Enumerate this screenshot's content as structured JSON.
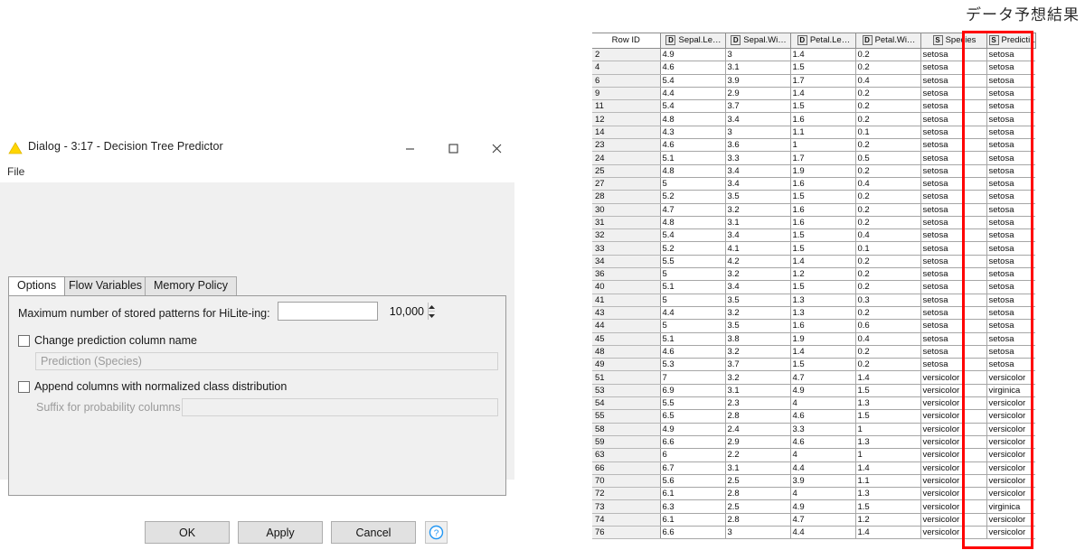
{
  "caption": "データ予想結果",
  "dialog": {
    "title": "Dialog - 3:17 - Decision Tree Predictor",
    "app_icon": "knime-triangle-icon",
    "window_controls": {
      "minimize": "minimize-icon",
      "maximize": "maximize-icon",
      "close": "close-icon"
    },
    "menu": {
      "file": "File"
    },
    "tabs": [
      {
        "label": "Options",
        "selected": true
      },
      {
        "label": "Flow Variables",
        "selected": false
      },
      {
        "label": "Memory Policy",
        "selected": false
      }
    ],
    "options": {
      "max_patterns_label": "Maximum number of stored patterns for HiLite-ing:",
      "max_patterns_value": "10,000",
      "change_prediction_checkbox": "Change prediction column name",
      "change_prediction_checked": false,
      "prediction_name_value": "Prediction (Species)",
      "append_distribution_checkbox": "Append columns with normalized class distribution",
      "append_distribution_checked": false,
      "suffix_label": "Suffix for probability columns",
      "suffix_value": ""
    },
    "buttons": {
      "ok": "OK",
      "apply": "Apply",
      "cancel": "Cancel",
      "help": "?"
    }
  },
  "colors": {
    "highlight": "#ff0000",
    "knime_yellow": "#ffd500",
    "help_blue": "#2196f3"
  },
  "table": {
    "columns": [
      {
        "label": "Row ID",
        "type": ""
      },
      {
        "label": "Sepal.Le…",
        "type": "D"
      },
      {
        "label": "Sepal.Wi…",
        "type": "D"
      },
      {
        "label": "Petal.Le…",
        "type": "D"
      },
      {
        "label": "Petal.Wi…",
        "type": "D"
      },
      {
        "label": "Species",
        "type": "S"
      },
      {
        "label": "Predicti…",
        "type": "S"
      }
    ],
    "highlighted_column_index": 6,
    "rows": [
      [
        "2",
        "4.9",
        "3",
        "1.4",
        "0.2",
        "setosa",
        "setosa"
      ],
      [
        "4",
        "4.6",
        "3.1",
        "1.5",
        "0.2",
        "setosa",
        "setosa"
      ],
      [
        "6",
        "5.4",
        "3.9",
        "1.7",
        "0.4",
        "setosa",
        "setosa"
      ],
      [
        "9",
        "4.4",
        "2.9",
        "1.4",
        "0.2",
        "setosa",
        "setosa"
      ],
      [
        "11",
        "5.4",
        "3.7",
        "1.5",
        "0.2",
        "setosa",
        "setosa"
      ],
      [
        "12",
        "4.8",
        "3.4",
        "1.6",
        "0.2",
        "setosa",
        "setosa"
      ],
      [
        "14",
        "4.3",
        "3",
        "1.1",
        "0.1",
        "setosa",
        "setosa"
      ],
      [
        "23",
        "4.6",
        "3.6",
        "1",
        "0.2",
        "setosa",
        "setosa"
      ],
      [
        "24",
        "5.1",
        "3.3",
        "1.7",
        "0.5",
        "setosa",
        "setosa"
      ],
      [
        "25",
        "4.8",
        "3.4",
        "1.9",
        "0.2",
        "setosa",
        "setosa"
      ],
      [
        "27",
        "5",
        "3.4",
        "1.6",
        "0.4",
        "setosa",
        "setosa"
      ],
      [
        "28",
        "5.2",
        "3.5",
        "1.5",
        "0.2",
        "setosa",
        "setosa"
      ],
      [
        "30",
        "4.7",
        "3.2",
        "1.6",
        "0.2",
        "setosa",
        "setosa"
      ],
      [
        "31",
        "4.8",
        "3.1",
        "1.6",
        "0.2",
        "setosa",
        "setosa"
      ],
      [
        "32",
        "5.4",
        "3.4",
        "1.5",
        "0.4",
        "setosa",
        "setosa"
      ],
      [
        "33",
        "5.2",
        "4.1",
        "1.5",
        "0.1",
        "setosa",
        "setosa"
      ],
      [
        "34",
        "5.5",
        "4.2",
        "1.4",
        "0.2",
        "setosa",
        "setosa"
      ],
      [
        "36",
        "5",
        "3.2",
        "1.2",
        "0.2",
        "setosa",
        "setosa"
      ],
      [
        "40",
        "5.1",
        "3.4",
        "1.5",
        "0.2",
        "setosa",
        "setosa"
      ],
      [
        "41",
        "5",
        "3.5",
        "1.3",
        "0.3",
        "setosa",
        "setosa"
      ],
      [
        "43",
        "4.4",
        "3.2",
        "1.3",
        "0.2",
        "setosa",
        "setosa"
      ],
      [
        "44",
        "5",
        "3.5",
        "1.6",
        "0.6",
        "setosa",
        "setosa"
      ],
      [
        "45",
        "5.1",
        "3.8",
        "1.9",
        "0.4",
        "setosa",
        "setosa"
      ],
      [
        "48",
        "4.6",
        "3.2",
        "1.4",
        "0.2",
        "setosa",
        "setosa"
      ],
      [
        "49",
        "5.3",
        "3.7",
        "1.5",
        "0.2",
        "setosa",
        "setosa"
      ],
      [
        "51",
        "7",
        "3.2",
        "4.7",
        "1.4",
        "versicolor",
        "versicolor"
      ],
      [
        "53",
        "6.9",
        "3.1",
        "4.9",
        "1.5",
        "versicolor",
        "virginica"
      ],
      [
        "54",
        "5.5",
        "2.3",
        "4",
        "1.3",
        "versicolor",
        "versicolor"
      ],
      [
        "55",
        "6.5",
        "2.8",
        "4.6",
        "1.5",
        "versicolor",
        "versicolor"
      ],
      [
        "58",
        "4.9",
        "2.4",
        "3.3",
        "1",
        "versicolor",
        "versicolor"
      ],
      [
        "59",
        "6.6",
        "2.9",
        "4.6",
        "1.3",
        "versicolor",
        "versicolor"
      ],
      [
        "63",
        "6",
        "2.2",
        "4",
        "1",
        "versicolor",
        "versicolor"
      ],
      [
        "66",
        "6.7",
        "3.1",
        "4.4",
        "1.4",
        "versicolor",
        "versicolor"
      ],
      [
        "70",
        "5.6",
        "2.5",
        "3.9",
        "1.1",
        "versicolor",
        "versicolor"
      ],
      [
        "72",
        "6.1",
        "2.8",
        "4",
        "1.3",
        "versicolor",
        "versicolor"
      ],
      [
        "73",
        "6.3",
        "2.5",
        "4.9",
        "1.5",
        "versicolor",
        "virginica"
      ],
      [
        "74",
        "6.1",
        "2.8",
        "4.7",
        "1.2",
        "versicolor",
        "versicolor"
      ],
      [
        "76",
        "6.6",
        "3",
        "4.4",
        "1.4",
        "versicolor",
        "versicolor"
      ]
    ]
  }
}
